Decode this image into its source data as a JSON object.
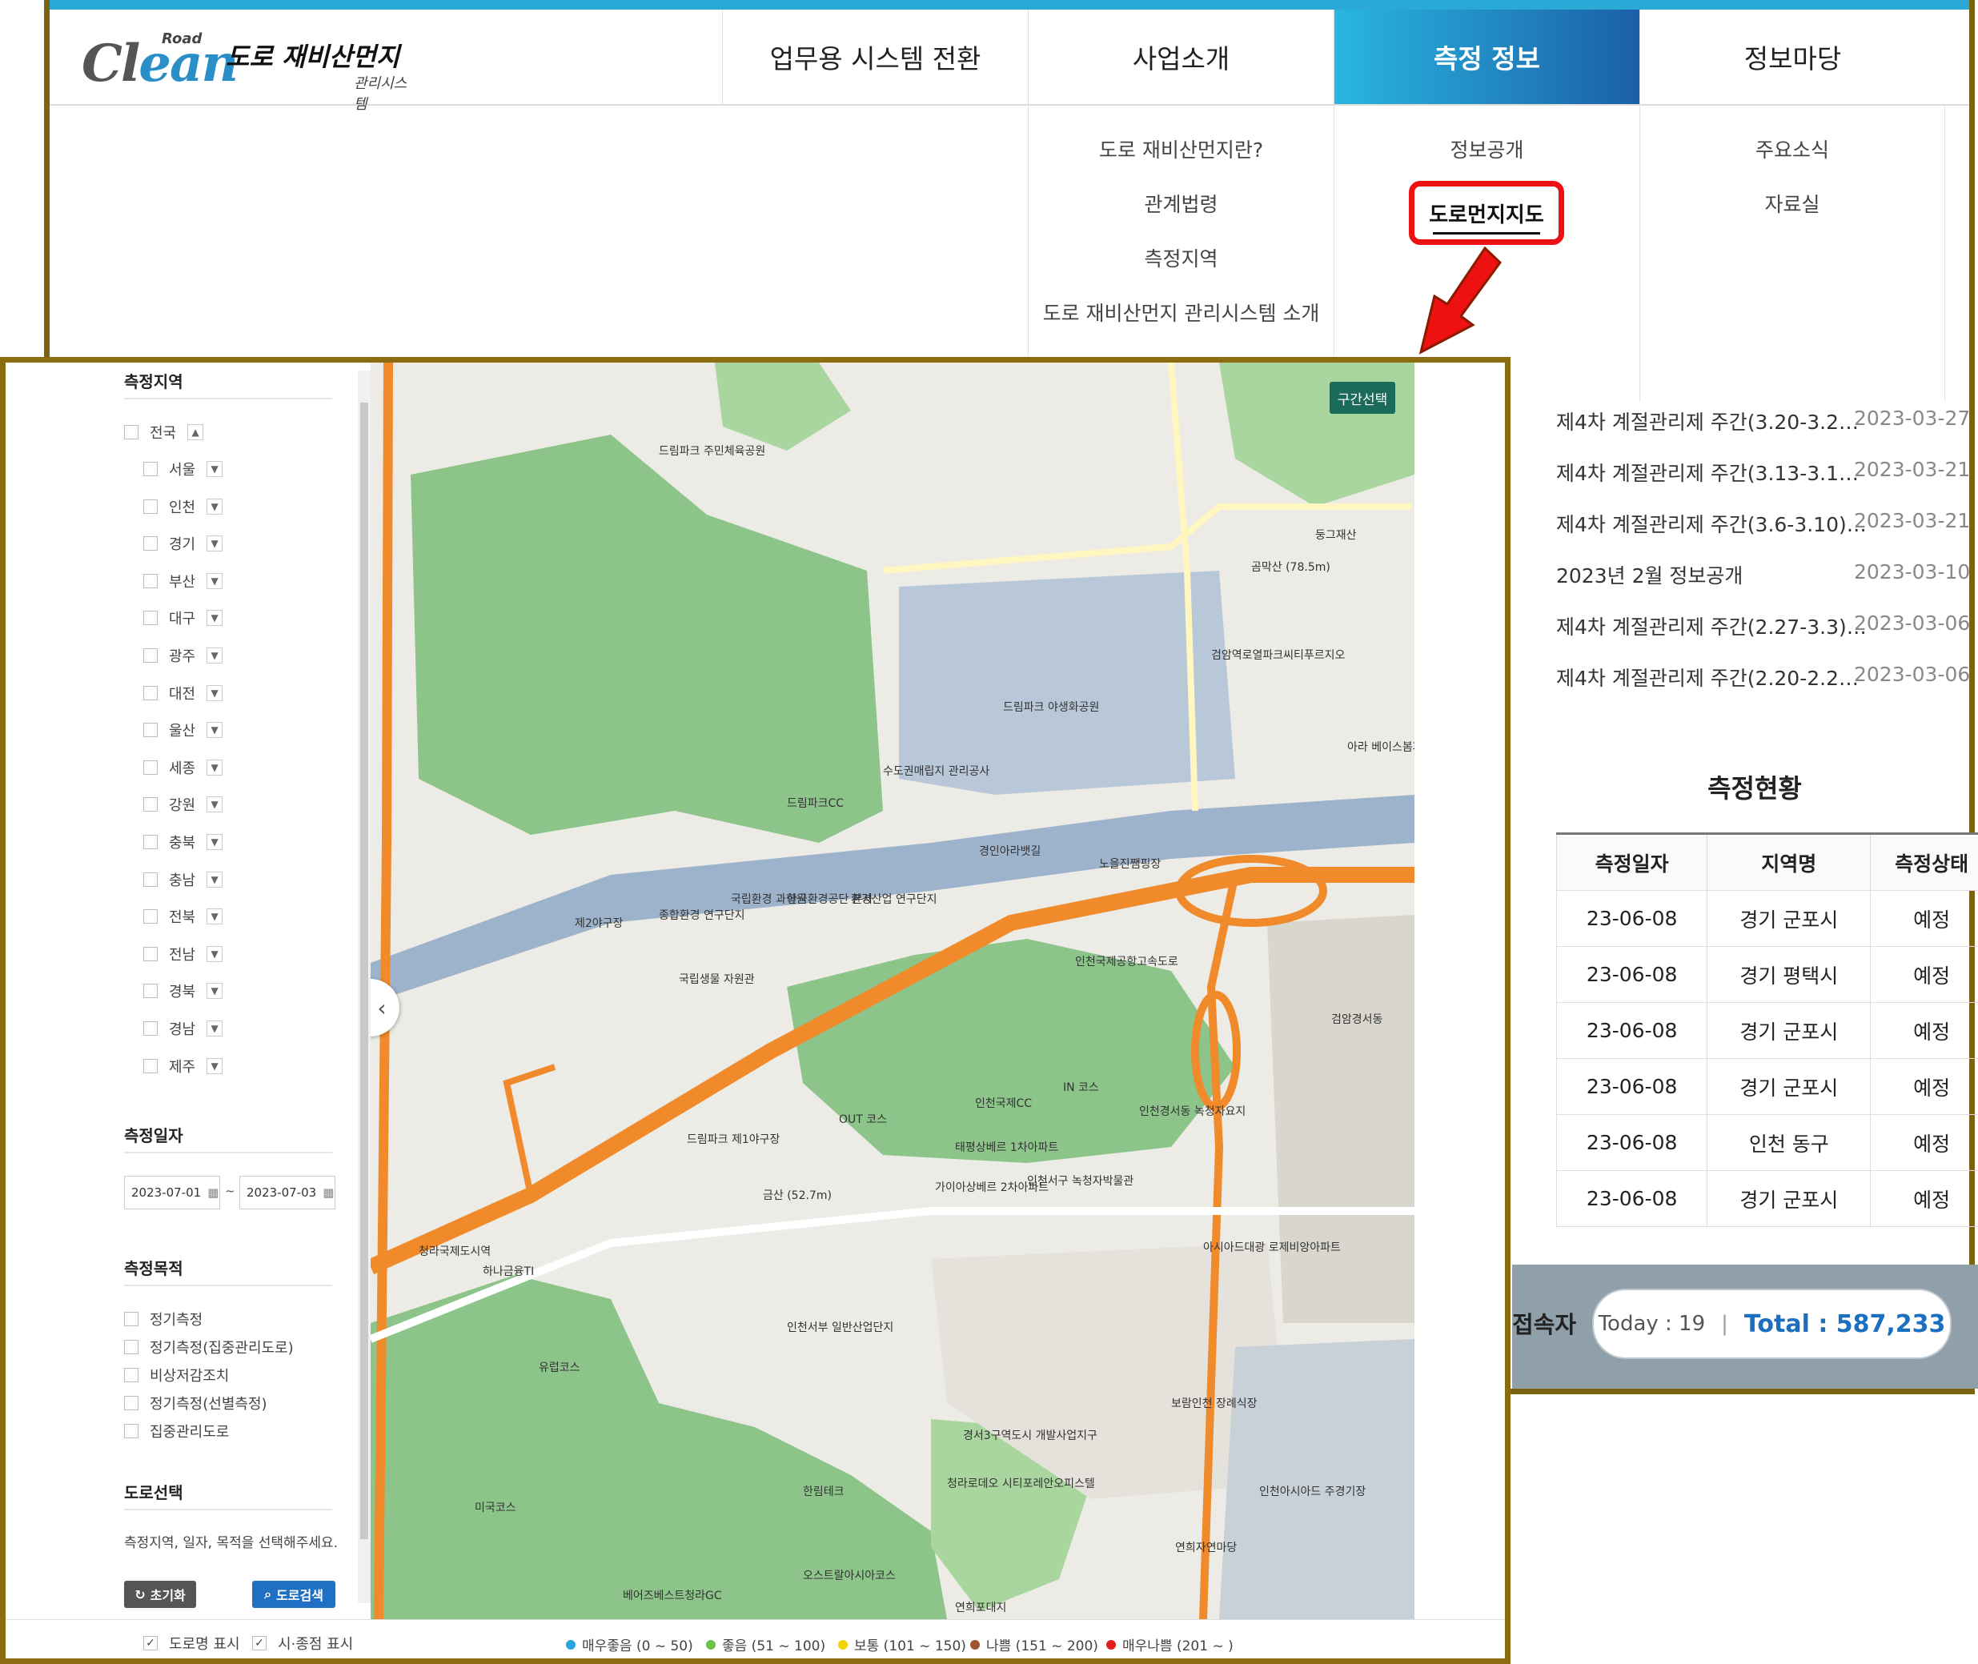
{
  "logo": {
    "clean": "Clean",
    "road": "Road",
    "title": "도로 재비산먼지",
    "subtitle": "관리시스템"
  },
  "nav": [
    {
      "label": "업무용 시스템 전환"
    },
    {
      "label": "사업소개"
    },
    {
      "label": "측정 정보"
    },
    {
      "label": "정보마당"
    }
  ],
  "dropdown": {
    "col1": [
      "도로 재비산먼지란?",
      "관계법령",
      "측정지역",
      "도로 재비산먼지 관리시스템 소개"
    ],
    "col2_first": "정보공개",
    "col2_highlight": "도로먼지지도",
    "col3": [
      "주요소식",
      "자료실"
    ]
  },
  "news": [
    {
      "title": "제4차 계절관리제 주간(3.20-3.2…",
      "date": "2023-03-27"
    },
    {
      "title": "제4차 계절관리제 주간(3.13-3.1…",
      "date": "2023-03-21"
    },
    {
      "title": "제4차 계절관리제 주간(3.6-3.10)…",
      "date": "2023-03-21"
    },
    {
      "title": "2023년 2월 정보공개",
      "date": "2023-03-10"
    },
    {
      "title": "제4차 계절관리제 주간(2.27-3.3)…",
      "date": "2023-03-06"
    },
    {
      "title": "제4차 계절관리제 주간(2.20-2.2…",
      "date": "2023-03-06"
    }
  ],
  "status": {
    "title": "측정현황",
    "headers": [
      "측정일자",
      "지역명",
      "측정상태"
    ],
    "rows": [
      [
        "23-06-08",
        "경기 군포시",
        "예정"
      ],
      [
        "23-06-08",
        "경기 평택시",
        "예정"
      ],
      [
        "23-06-08",
        "경기 군포시",
        "예정"
      ],
      [
        "23-06-08",
        "경기 군포시",
        "예정"
      ],
      [
        "23-06-08",
        "인천 동구",
        "예정"
      ],
      [
        "23-06-08",
        "경기 군포시",
        "예정"
      ]
    ]
  },
  "visitor": {
    "label": "접속자",
    "today": "Today : 19",
    "total": "Total : 587,233"
  },
  "sidebar": {
    "region_title": "측정지역",
    "all": "전국",
    "regions": [
      "서울",
      "인천",
      "경기",
      "부산",
      "대구",
      "광주",
      "대전",
      "울산",
      "세종",
      "강원",
      "충북",
      "충남",
      "전북",
      "전남",
      "경북",
      "경남",
      "제주"
    ],
    "date_title": "측정일자",
    "date_from": "2023-07-01",
    "date_sep": "~",
    "date_to": "2023-07-03",
    "purpose_title": "측정목적",
    "purposes": [
      "정기측정",
      "정기측정(집중관리도로)",
      "비상저감조치",
      "정기측정(선별측정)",
      "집중관리도로"
    ],
    "road_title": "도로선택",
    "road_hint": "측정지역, 일자, 목적을 선택해주세요.",
    "reset": "초기화",
    "search": "도로검색"
  },
  "bottom": {
    "show_road_names": "도로명 표시",
    "show_points": "시·종점 표시",
    "legend": [
      {
        "label": "매우좋음 (0 ~ 50)",
        "color": "#2aa5e0"
      },
      {
        "label": "좋음 (51 ~ 100)",
        "color": "#6cc24a"
      },
      {
        "label": "보통 (101 ~ 150)",
        "color": "#f2d300"
      },
      {
        "label": "나쁨 (151 ~ 200)",
        "color": "#a0522d"
      },
      {
        "label": "매우나쁨 (201 ~ )",
        "color": "#e02020"
      }
    ]
  },
  "map": {
    "section_select": "구간선택",
    "labels": [
      "드림파크 주민체육공원",
      "드림파크 야생화공원",
      "수도권매립지 관리공사",
      "드림파크CC",
      "경인아라뱃길",
      "노을진쨈핑장",
      "국립환경 과학원",
      "한국환경공단 본사",
      "환경산업 연구단지",
      "종합환경 연구단지",
      "국립생물 자원관",
      "제2야구장",
      "드림파크 제1야구장",
      "OUT 코스",
      "IN 코스",
      "인천국제CC",
      "태평상베르 1차아파트",
      "가이아상베르 2차아파트",
      "인천서구 녹청자박물관",
      "인천경서동 녹청자요지",
      "금산 (52.7m)",
      "하나금융TI",
      "청라국제도시역",
      "인천서부 일반산업단지",
      "보람인천 장례식장",
      "경서3구역도시 개발사업지구",
      "청라로데오 시티포레안오피스텔",
      "유럽코스",
      "미국코스",
      "한림테크",
      "베어즈베스트청라GC",
      "오스트랄아시아코스",
      "인천아시아드 주경기장",
      "연희자연마당",
      "연희포대지",
      "아시아드대광 로제비앙아파트",
      "곰막산 (78.5m)",
      "둥그재산",
      "검암역로열파크씨티푸르지오",
      "아라 베이스봄파크",
      "검암경서동",
      "인천국제공항고속도로"
    ]
  }
}
